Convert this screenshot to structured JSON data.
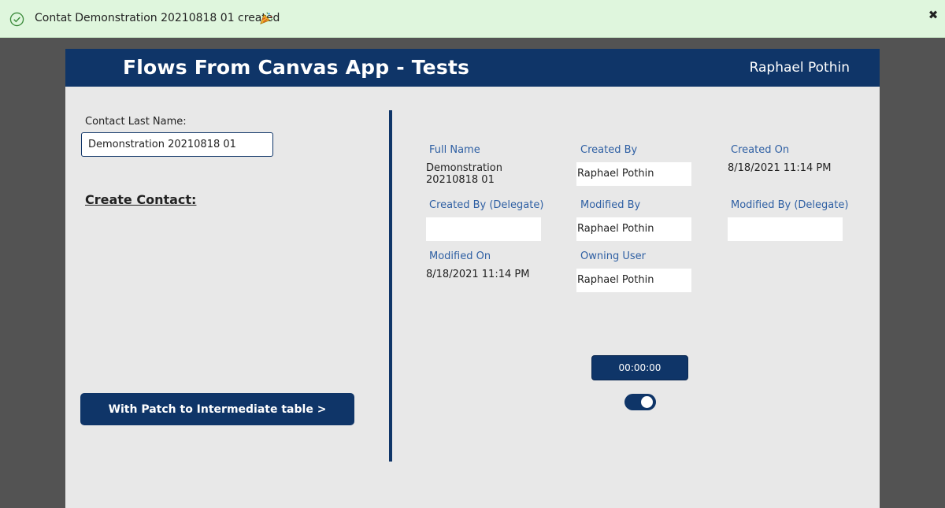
{
  "notification": {
    "message": "Contat Demonstration 20210818 01 created",
    "icon": "check-circle-icon",
    "emoji": "party-popper-icon",
    "close_label": "✖",
    "color": "#dff6dd"
  },
  "app": {
    "title": "Flows From Canvas App - Tests",
    "user": "Raphael Pothin",
    "accent": "#0f3568"
  },
  "form": {
    "last_name_label": "Contact Last Name:",
    "last_name_value": "Demonstration 20210818 01",
    "create_label": "Create Contact:",
    "patch_button": "With Patch to Intermediate table >"
  },
  "details": {
    "full_name_label": "Full Name",
    "full_name_value": "Demonstration 20210818 01",
    "created_by_label": "Created By",
    "created_by_value": "Raphael Pothin",
    "created_on_label": "Created On",
    "created_on_value": "8/18/2021 11:14 PM",
    "created_by_delegate_label": "Created By (Delegate)",
    "created_by_delegate_value": "",
    "modified_by_label": "Modified By",
    "modified_by_value": "Raphael Pothin",
    "modified_by_delegate_label": "Modified By (Delegate)",
    "modified_by_delegate_value": "",
    "modified_on_label": "Modified On",
    "modified_on_value": "8/18/2021 11:14 PM",
    "owning_user_label": "Owning User",
    "owning_user_value": "Raphael Pothin"
  },
  "timer": {
    "value": "00:00:00"
  },
  "toggle": {
    "on": true
  }
}
